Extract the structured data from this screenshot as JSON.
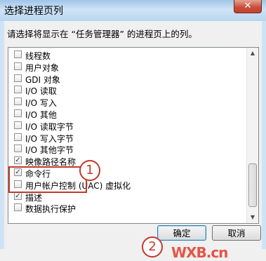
{
  "window": {
    "title": "选择进程页列",
    "close_label": "✕"
  },
  "instruction": "请选择将显示在 “任务管理器” 的进程页上的列。",
  "columns": [
    {
      "label": "线程数",
      "checked": false
    },
    {
      "label": "用户对象",
      "checked": false
    },
    {
      "label": "GDI 对象",
      "checked": false
    },
    {
      "label": "I/O 读取",
      "checked": false
    },
    {
      "label": "I/O 写入",
      "checked": false
    },
    {
      "label": "I/O 其他",
      "checked": false
    },
    {
      "label": "I/O 读取字节",
      "checked": false
    },
    {
      "label": "I/O 写入字节",
      "checked": false
    },
    {
      "label": "I/O 其他字节",
      "checked": false
    },
    {
      "label": "映像路径名称",
      "checked": true
    },
    {
      "label": "命令行",
      "checked": true
    },
    {
      "label": "用户帐户控制 (UAC) 虚拟化",
      "checked": false
    },
    {
      "label": "描述",
      "checked": true
    },
    {
      "label": "数据执行保护",
      "checked": false
    }
  ],
  "annotations": {
    "callout1": "1",
    "callout2": "2"
  },
  "buttons": {
    "ok": "确定",
    "cancel": "取消"
  },
  "watermark": "WXB.cn",
  "scroll_arrows": {
    "up": "▲",
    "down": "▼"
  }
}
